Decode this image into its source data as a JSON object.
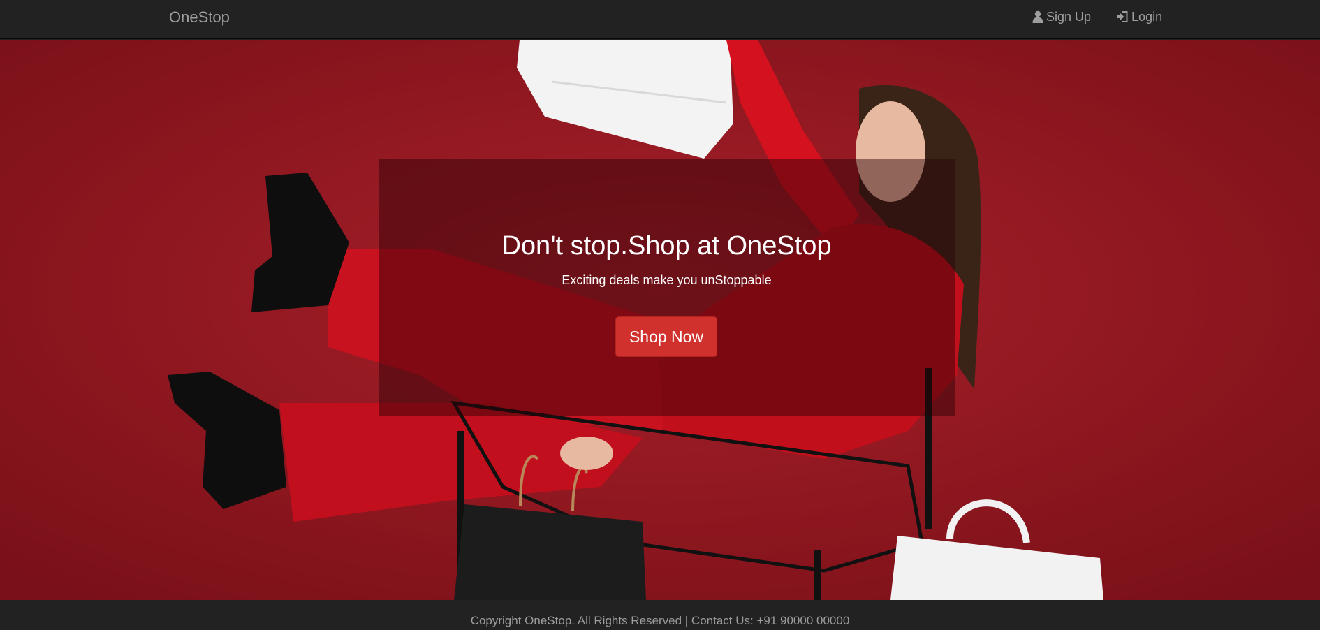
{
  "navbar": {
    "brand": "OneStop",
    "links": [
      {
        "label": "Sign Up",
        "icon": "user-icon"
      },
      {
        "label": "Login",
        "icon": "login-icon"
      }
    ]
  },
  "hero": {
    "headline": "Don't stop.Shop at OneStop",
    "tagline": "Exciting deals make you unStoppable",
    "cta_label": "Shop Now"
  },
  "footer": {
    "text": "Copyright OneStop. All Rights Reserved | Contact Us: +91 90000 00000"
  },
  "colors": {
    "navbar_bg": "#222222",
    "nav_text": "#9d9d9d",
    "hero_bg": "#8f1620",
    "cta_bg": "#d0312d"
  }
}
